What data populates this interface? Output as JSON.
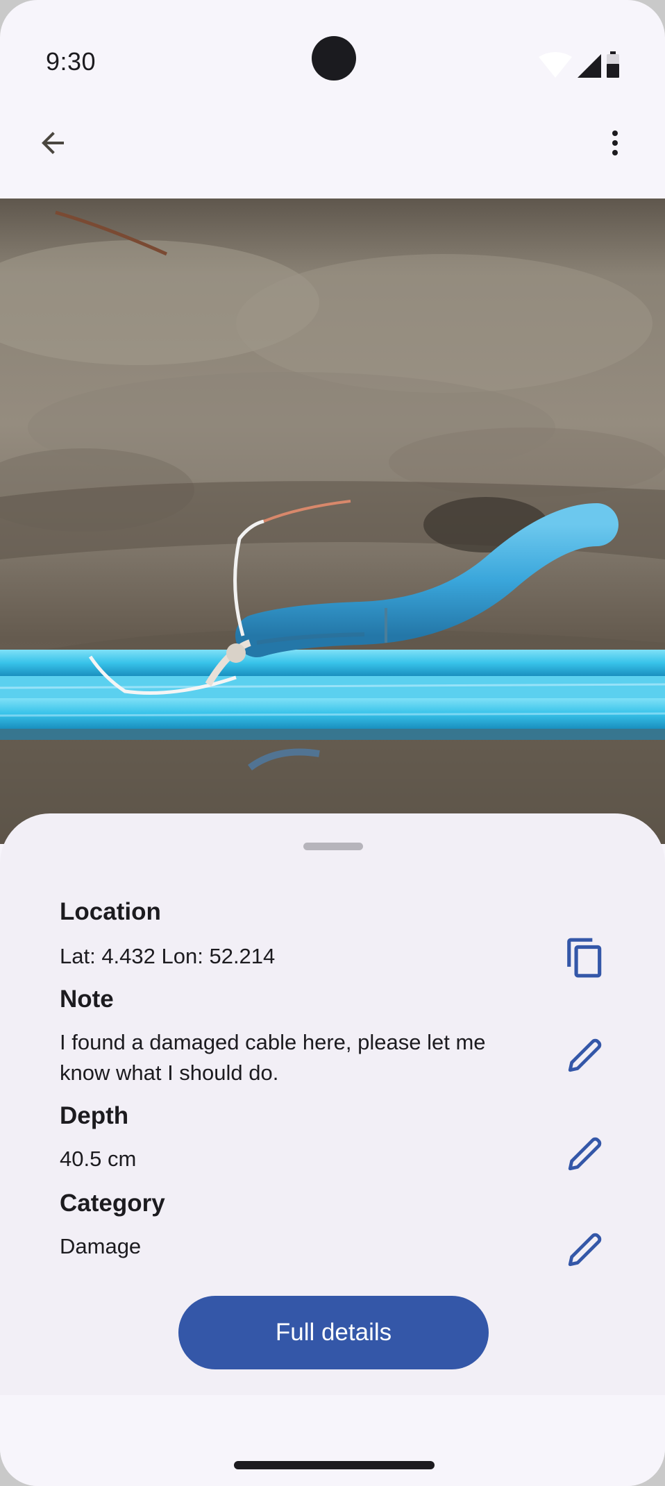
{
  "status_bar": {
    "time": "9:30",
    "icons": [
      "wifi-icon",
      "cellular-signal-icon",
      "battery-icon"
    ]
  },
  "app_bar": {
    "back_icon": "arrow-back-icon",
    "menu_icon": "more-vert-icon"
  },
  "photo": {
    "subject": "damaged-cable-photo"
  },
  "details": {
    "location": {
      "title": "Location",
      "value": "Lat: 4.432 Lon: 52.214",
      "action_icon": "copy-icon"
    },
    "note": {
      "title": "Note",
      "value": "I found a damaged cable here, please let me know what I should do.",
      "action_icon": "edit-pencil-icon"
    },
    "depth": {
      "title": "Depth",
      "value": "40.5 cm",
      "action_icon": "edit-pencil-icon"
    },
    "category": {
      "title": "Category",
      "value": "Damage",
      "action_icon": "edit-pencil-icon"
    }
  },
  "full_details_button": "Full details",
  "colors": {
    "primary": "#3457a8",
    "icon_blue": "#3457a8",
    "surface": "#f2eff6",
    "background": "#f7f5fb",
    "text": "#1c1b1f"
  }
}
